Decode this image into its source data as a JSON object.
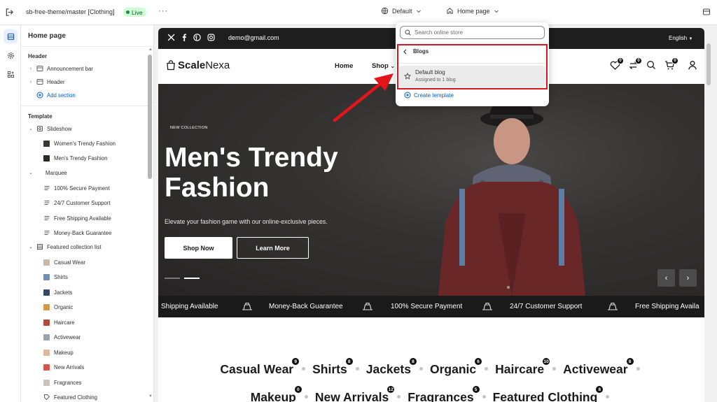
{
  "topbar": {
    "store_name": "sb-free-theme/master [Clothing]",
    "status": "Live",
    "more": "···",
    "theme_select": "Default",
    "page_select": "Home page"
  },
  "sidebar": {
    "title": "Home page",
    "header_group": "Header",
    "items_header": [
      "Announcement bar",
      "Header"
    ],
    "add_section": "Add section",
    "template_group": "Template",
    "slideshow": "Slideshow",
    "slides": [
      "Women's Trendy Fashion",
      "Men's Trendy Fashion"
    ],
    "marquee": "Marquee",
    "marquee_items": [
      "100% Secure Payment",
      "24/7 Customer Support",
      "Free Shipping Available",
      "Money-Back Guarantee"
    ],
    "featured": "Featured collection list",
    "collections": [
      "Casual Wear",
      "Shirts",
      "Jackets",
      "Organic",
      "Haircare",
      "Activewear",
      "Makeup",
      "New Arrivals",
      "Fragrances",
      "Featured Clothing"
    ]
  },
  "dropdown": {
    "search_placeholder": "Search online store",
    "back_label": "Blogs",
    "blog_title": "Default blog",
    "blog_sub": "Assigned to 1 blog",
    "create": "Create template"
  },
  "preview": {
    "email": "demo@gmail.com",
    "language": "English",
    "logo_bold": "Scale",
    "logo_light": "Nexa",
    "nav": [
      "Home",
      "Shop"
    ],
    "badges": [
      "0",
      "0",
      "0"
    ],
    "hero_kicker": "NEW COLLECTION",
    "hero_title": "Men's Trendy Fashion",
    "hero_sub": "Elevate your fashion game with our online-exclusive pieces.",
    "btn_shop": "Shop Now",
    "btn_learn": "Learn More",
    "marquee": [
      "Shipping Available",
      "Money-Back Guarantee",
      "100% Secure Payment",
      "24/7 Customer Support",
      "Free Shipping Availa"
    ],
    "collections_row1": [
      {
        "name": "Casual Wear",
        "count": "9"
      },
      {
        "name": "Shirts",
        "count": "8"
      },
      {
        "name": "Jackets",
        "count": "8"
      },
      {
        "name": "Organic",
        "count": "6"
      },
      {
        "name": "Haircare",
        "count": "10"
      },
      {
        "name": "Activewear",
        "count": "8"
      }
    ],
    "collections_row2": [
      {
        "name": "Makeup",
        "count": "0"
      },
      {
        "name": "New Arrivals",
        "count": "12"
      },
      {
        "name": "Fragrances",
        "count": "5"
      },
      {
        "name": "Featured Clothing",
        "count": "8"
      }
    ]
  },
  "colors": {
    "accent_blue": "#005bd3",
    "live_green": "#29845a",
    "highlight_red": "#e3151a",
    "hero_bg": "#2e2b2b"
  }
}
